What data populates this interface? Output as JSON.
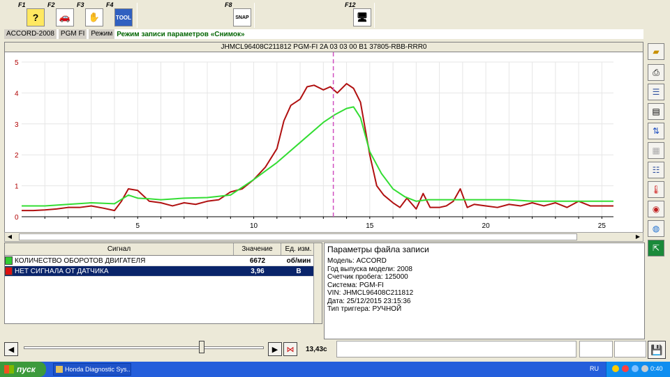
{
  "toolbar": {
    "keys": [
      {
        "label": "F1",
        "icon": "help-icon",
        "glyph": "?"
      },
      {
        "label": "F2",
        "icon": "car-icon",
        "glyph": "🚗"
      },
      {
        "label": "F3",
        "icon": "scan-tool-icon",
        "glyph": "✋"
      },
      {
        "label": "F4",
        "icon": "tool-icon",
        "glyph": "TOOL"
      },
      {
        "label": "F8",
        "icon": "snap-icon",
        "glyph": "SNAP"
      },
      {
        "label": "F12",
        "icon": "computer-icon",
        "glyph": "🖥"
      }
    ]
  },
  "mode_line": {
    "model": "ACCORD-2008",
    "system": "PGM FI",
    "mode_label": "Режим",
    "mode_text": "Режим записи параметров «Снимок»"
  },
  "chart_title": "JHMCL96408C211812  PGM-FI  2A 03 03 00 B1  37805-RBB-RRR0",
  "chart_data": {
    "type": "line",
    "xlim": [
      0,
      25.5
    ],
    "ylim": [
      0,
      5
    ],
    "x_ticks": [
      5,
      10,
      15,
      20,
      25
    ],
    "y_ticks": [
      0,
      1,
      2,
      3,
      4,
      5
    ],
    "grid": true,
    "cursor_x": 13.43,
    "colors": {
      "red": "#b01010",
      "green": "#33dd33",
      "cursor": "#d050c0",
      "axis_text": "#b00000"
    },
    "series": [
      {
        "color": "#b01010",
        "x": [
          0,
          0.5,
          1,
          1.5,
          2,
          2.5,
          3,
          3.5,
          4,
          4.3,
          4.6,
          5,
          5.5,
          6,
          6.5,
          7,
          7.5,
          8,
          8.5,
          9,
          9.5,
          10,
          10.5,
          11,
          11.3,
          11.6,
          12,
          12.3,
          12.6,
          13,
          13.3,
          13.6,
          14,
          14.3,
          14.6,
          15,
          15.3,
          15.6,
          16,
          16.3,
          16.6,
          17,
          17.3,
          17.6,
          18,
          18.3,
          18.6,
          18.9,
          19.2,
          19.5,
          20,
          20.5,
          21,
          21.5,
          22,
          22.5,
          23,
          23.5,
          24,
          24.5,
          25,
          25.5
        ],
        "values": [
          0.2,
          0.2,
          0.22,
          0.25,
          0.3,
          0.3,
          0.35,
          0.28,
          0.2,
          0.5,
          0.9,
          0.85,
          0.5,
          0.45,
          0.35,
          0.45,
          0.4,
          0.5,
          0.55,
          0.8,
          0.9,
          1.2,
          1.6,
          2.2,
          3.1,
          3.6,
          3.8,
          4.2,
          4.25,
          4.1,
          4.2,
          4.0,
          4.3,
          4.15,
          3.7,
          2.0,
          1.0,
          0.7,
          0.45,
          0.3,
          0.6,
          0.25,
          0.75,
          0.3,
          0.3,
          0.35,
          0.5,
          0.9,
          0.3,
          0.4,
          0.35,
          0.3,
          0.4,
          0.35,
          0.45,
          0.35,
          0.45,
          0.3,
          0.5,
          0.35,
          0.35,
          0.35
        ]
      },
      {
        "color": "#33dd33",
        "x": [
          0,
          1,
          2,
          3,
          4,
          4.6,
          5,
          5.5,
          6,
          7,
          8,
          9,
          10,
          11,
          12,
          13,
          13.5,
          14,
          14.3,
          14.6,
          15,
          15.5,
          16,
          16.5,
          17,
          17.5,
          18,
          19,
          20,
          21,
          22,
          23,
          24,
          25,
          25.5
        ],
        "values": [
          0.35,
          0.35,
          0.4,
          0.45,
          0.42,
          0.7,
          0.6,
          0.58,
          0.55,
          0.6,
          0.62,
          0.7,
          1.2,
          1.75,
          2.4,
          3.05,
          3.3,
          3.5,
          3.55,
          3.2,
          2.1,
          1.4,
          0.9,
          0.65,
          0.5,
          0.55,
          0.55,
          0.55,
          0.55,
          0.55,
          0.5,
          0.5,
          0.5,
          0.5,
          0.5
        ]
      }
    ]
  },
  "signals": {
    "headers": {
      "signal": "Сигнал",
      "value": "Значение",
      "unit": "Ед. изм."
    },
    "rows": [
      {
        "color": "#33cc33",
        "name": "КОЛИЧЕСТВО ОБОРОТОВ ДВИГАТЕЛЯ",
        "value": "6672",
        "unit": "об/мин"
      },
      {
        "color": "#dd1111",
        "name": "НЕТ СИГНАЛА ОТ ДАТЧИКА",
        "value": "3,96",
        "unit": "В"
      }
    ]
  },
  "params": {
    "title": "Параметры файла записи",
    "lines": [
      "Модель: ACCORD",
      "Год выпуска модели: 2008",
      "Счетчик пробега: 125000",
      "Система: PGM-FI",
      "VIN: JHMCL96408C211812",
      "Дата: 25/12/2015 23:15:36",
      "Тип триггера: РУЧНОЙ"
    ]
  },
  "playback": {
    "time": "13,43с",
    "position": 0.74
  },
  "sidebar_icons": [
    "open-folder-icon",
    "printer-icon",
    "list-edit-icon",
    "document-icon",
    "sort-icon",
    "blank-icon",
    "chart-settings-icon",
    "thermometer-icon",
    "camera-icon",
    "disk-icon",
    "exit-icon"
  ],
  "taskbar": {
    "start": "пуск",
    "task": "Honda Diagnostic Sys...",
    "lang": "RU",
    "clock": "0:40"
  }
}
